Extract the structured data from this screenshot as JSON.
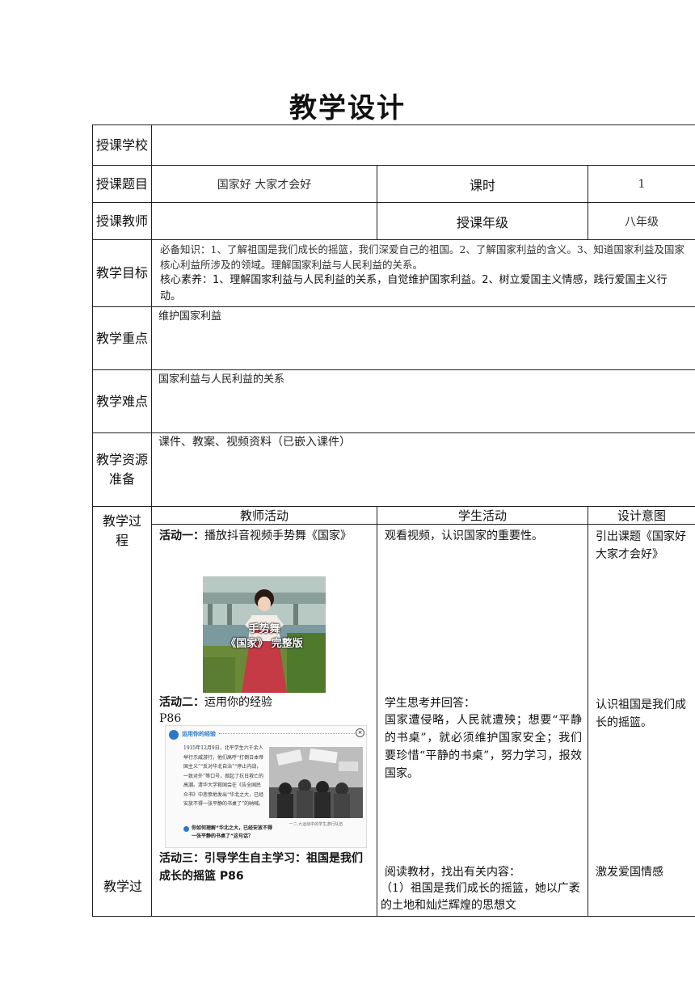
{
  "title": "教学设计",
  "rows": {
    "school_label": "授课学校",
    "school_value": "",
    "topic_label": "授课题目",
    "topic_value": "国家好  大家才会好",
    "period_label": "课时",
    "period_value": "1",
    "teacher_label": "授课教师",
    "teacher_value": "",
    "grade_label": "授课年级",
    "grade_value": "八年级",
    "goals_label": "教学目标",
    "goals_line1": "必备知识：1、了解祖国是我们成长的摇篮，我们深爱自己的祖国。2、了解国家利益的含义。3、知道国家利益及国家核心利益所涉及的领域。理解国家利益与人民利益的关系。",
    "goals_line2": "核心素养：1、理解国家利益与人民利益的关系，自觉维护国家利益。2、树立爱国主义情感，践行爱国主义行动。",
    "key_label": "教学重点",
    "key_value": "维护国家利益",
    "difficult_label": "教学难点",
    "difficult_value": "国家利益与人民利益的关系",
    "resources_label": "教学资源准备",
    "resources_value": "课件、教案、视频资料（已嵌入课件）",
    "process_label": "教学过程",
    "process_label_bottom": "教学过"
  },
  "process": {
    "headers": {
      "teacher": "教师活动",
      "student": "学生活动",
      "intent": "设计意图"
    },
    "act1_prefix": "活动一：",
    "act1_text": "播放抖音视频手势舞《国家》",
    "video_caption_1": "手势舞",
    "video_caption_2": "《国家》 完整版",
    "act2_prefix": "活动二：",
    "act2_text": "运用你的经验",
    "act2_page": "P86",
    "book_header": "运用你的经验",
    "book_text": "1935年12月9日，北平学生六千余人举行示威游行，他们高呼“打倒日本帝国主义”“反对华北自治”“停止内战，一致对外”等口号，掀起了抗日救亡的高潮。清华大学救国会在《告全国民众书》中悲愤地发出“华北之大，已经安放不得一张平静的书桌了”的呐喊。",
    "book_question": "你如何理解“华北之大，已经安放不得一张平静的书桌了”这句话？",
    "book_photo_caption": "一二·九运动中的学生游行队伍",
    "act3_text": "活动三：引导学生自主学习：祖国是我们成长的摇篮 P86",
    "stu1": "观看视频，认识国家的重要性。",
    "stu2_title": "学生思考并回答：",
    "stu2_text": "国家遭侵略，人民就遭殃；想要“平静的书桌”，就必须维护国家安全；我们要珍惜“平静的书桌”，努力学习，报效国家。",
    "stu3_line1": "阅读教材，找出有关内容：",
    "stu3_line2": "（1）祖国是我们成长的摇篮，她以广袤的土地和灿烂辉煌的思想文",
    "int1": "引出课题《国家好  大家才会好》",
    "int2": "认识祖国是我们成长的摇篮。",
    "int3": "激发爱国情感"
  },
  "colors": {
    "border": "#222222",
    "book_blue": "#2a78c8"
  }
}
